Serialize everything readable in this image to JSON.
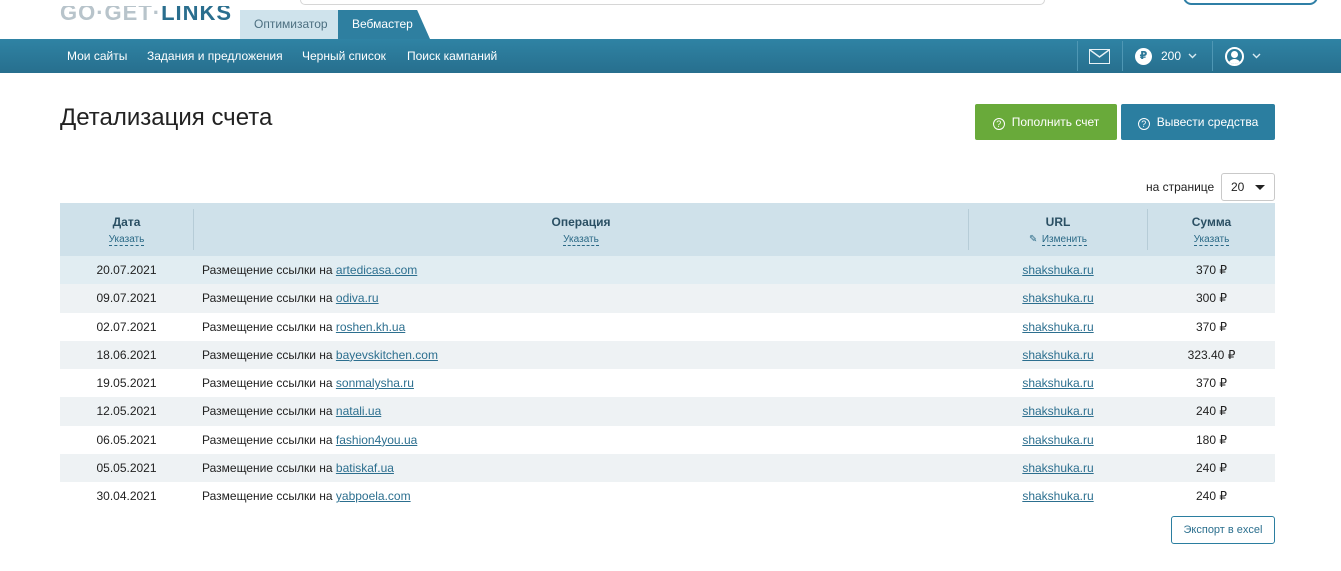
{
  "logo": {
    "part1": "GO·GET·",
    "part2": "LINKS"
  },
  "role_tabs": [
    {
      "label": "Оптимизатор",
      "active": false
    },
    {
      "label": "Вебмастер",
      "active": true
    }
  ],
  "nav": {
    "items": [
      "Мои сайты",
      "Задания и предложения",
      "Черный список",
      "Поиск кампаний"
    ],
    "balance_symbol": "₽",
    "balance": "200",
    "icons": [
      "mail-icon",
      "ruble-icon",
      "chevron-down-icon",
      "user-icon",
      "chevron-down-icon"
    ]
  },
  "page": {
    "title": "Детализация счета",
    "btn_deposit": "Пополнить счет",
    "btn_withdraw": "Вывести средства",
    "per_page_label": "на странице",
    "per_page_value": "20",
    "export_label": "Экспорт в excel"
  },
  "table": {
    "headers": {
      "date": {
        "title": "Дата",
        "sub": "Указать"
      },
      "operation": {
        "title": "Операция",
        "sub": "Указать"
      },
      "url": {
        "title": "URL",
        "sub": "Изменить"
      },
      "sum": {
        "title": "Сумма",
        "sub": "Указать"
      }
    },
    "op_prefix": "Размещение ссылки на",
    "rows": [
      {
        "date": "20.07.2021",
        "site": "artedicasa.com",
        "url": "shakshuka.ru",
        "sum": "370 ₽"
      },
      {
        "date": "09.07.2021",
        "site": "odiva.ru",
        "url": "shakshuka.ru",
        "sum": "300 ₽"
      },
      {
        "date": "02.07.2021",
        "site": "roshen.kh.ua",
        "url": "shakshuka.ru",
        "sum": "370 ₽"
      },
      {
        "date": "18.06.2021",
        "site": "bayevskitchen.com",
        "url": "shakshuka.ru",
        "sum": "323.40 ₽"
      },
      {
        "date": "19.05.2021",
        "site": "sonmalysha.ru",
        "url": "shakshuka.ru",
        "sum": "370 ₽"
      },
      {
        "date": "12.05.2021",
        "site": "natali.ua",
        "url": "shakshuka.ru",
        "sum": "240 ₽"
      },
      {
        "date": "06.05.2021",
        "site": "fashion4you.ua",
        "url": "shakshuka.ru",
        "sum": "180 ₽"
      },
      {
        "date": "05.05.2021",
        "site": "batiskaf.ua",
        "url": "shakshuka.ru",
        "sum": "240 ₽"
      },
      {
        "date": "30.04.2021",
        "site": "yabpoela.com",
        "url": "shakshuka.ru",
        "sum": "240 ₽"
      }
    ]
  },
  "colors": {
    "nav_bg": "#2b7b9c",
    "green_button": "#69aa3a",
    "blue_button": "#2b7ea0",
    "header_bg": "#cfe1ea",
    "link": "#2c6f8f"
  }
}
